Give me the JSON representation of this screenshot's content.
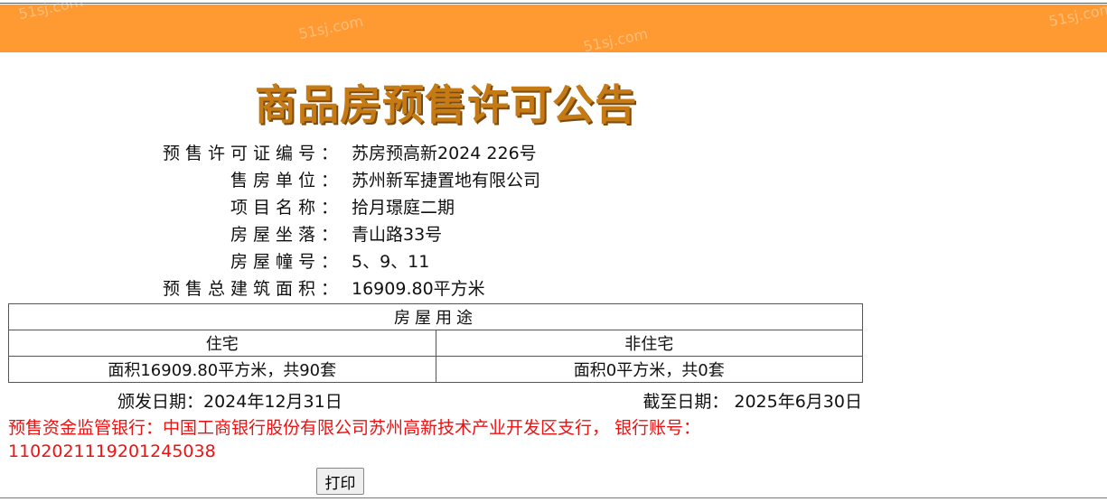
{
  "header": {
    "watermark": "51sj.com"
  },
  "title": "商品房预售许可公告",
  "info": [
    {
      "label": "预售许可证编号：",
      "value": "苏房预高新2024 226号"
    },
    {
      "label": "售房单位：",
      "value": "苏州新军捷置地有限公司"
    },
    {
      "label": "项目名称：",
      "value": "拾月璟庭二期"
    },
    {
      "label": "房屋坐落：",
      "value": "青山路33号"
    },
    {
      "label": "房屋幢号：",
      "value": "5、9、11"
    },
    {
      "label": "预售总建筑面积：",
      "value": "16909.80平方米"
    }
  ],
  "usage_table": {
    "header": "房屋用途",
    "columns": [
      "住宅",
      "非住宅"
    ],
    "values": [
      "面积16909.80平方米，共90套",
      "面积0平方米，共0套"
    ]
  },
  "dates": {
    "issue": "颁发日期：2024年12月31日",
    "expire": "截至日期： 2025年6月30日"
  },
  "bank": {
    "text": "预售资金监管银行：中国工商银行股份有限公司苏州高新技术产业开发区支行， 银行账号：1102021119201245038"
  },
  "print_label": "打印",
  "colors": {
    "header_band": "#ff9a33",
    "title": "#c57a14",
    "bank_text": "#ee1111"
  }
}
